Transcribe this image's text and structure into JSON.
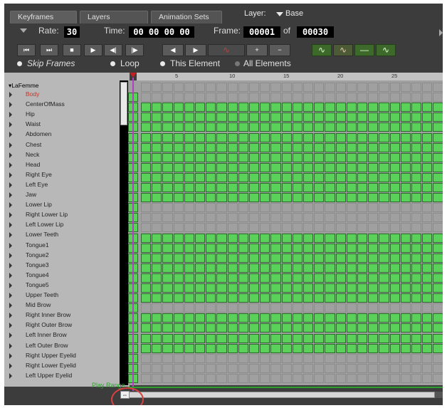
{
  "tabs": [
    {
      "label": "Keyframes",
      "active": true
    },
    {
      "label": "Layers",
      "active": false
    },
    {
      "label": "Animation Sets",
      "active": false
    }
  ],
  "layer": {
    "label": "Layer:",
    "value": "Base"
  },
  "rate": {
    "label": "Rate:",
    "value": "30"
  },
  "time": {
    "label": "Time:",
    "value": "00 00 00 00"
  },
  "frame": {
    "label": "Frame:",
    "value": "00001",
    "of_label": "of",
    "total": "00030"
  },
  "transport": [
    "⏮",
    "⏭",
    "■",
    "▶",
    "◀|",
    "|▶"
  ],
  "nav": [
    "◀",
    "▶"
  ],
  "key_tools": [
    "∿",
    "+",
    "−"
  ],
  "interp_buttons": [
    "∿",
    "∿",
    "—",
    "∿"
  ],
  "options": {
    "skip_frames": "Skip Frames",
    "loop": "Loop",
    "this_element": "This Element",
    "all_elements": "All Elements"
  },
  "ruler_ticks": [
    "5",
    "10",
    "15",
    "20",
    "25"
  ],
  "figure": "LaFemme",
  "rows": [
    {
      "label": "Body",
      "selected": true,
      "keys": false
    },
    {
      "label": "CenterOfMass",
      "keys": true
    },
    {
      "label": "Hip",
      "keys": true
    },
    {
      "label": "Waist",
      "keys": true
    },
    {
      "label": "Abdomen",
      "keys": true
    },
    {
      "label": "Chest",
      "keys": true
    },
    {
      "label": "Neck",
      "keys": true
    },
    {
      "label": "Head",
      "keys": true
    },
    {
      "label": "Right Eye",
      "keys": true
    },
    {
      "label": "Left Eye",
      "keys": true
    },
    {
      "label": "Jaw",
      "keys": true
    },
    {
      "label": "Lower Lip",
      "keys": false
    },
    {
      "label": "Right Lower Lip",
      "keys": false
    },
    {
      "label": "Left Lower Lip",
      "keys": false
    },
    {
      "label": "Lower Teeth",
      "keys": true
    },
    {
      "label": "Tongue1",
      "keys": true
    },
    {
      "label": "Tongue2",
      "keys": true
    },
    {
      "label": "Tongue3",
      "keys": true
    },
    {
      "label": "Tongue4",
      "keys": true
    },
    {
      "label": "Tongue5",
      "keys": true
    },
    {
      "label": "Upper Teeth",
      "keys": true
    },
    {
      "label": "Mid Brow",
      "keys": false
    },
    {
      "label": "Right Inner Brow",
      "keys": true
    },
    {
      "label": "Right Outer Brow",
      "keys": true
    },
    {
      "label": "Left Inner Brow",
      "keys": true
    },
    {
      "label": "Left Outer Brow",
      "keys": true
    },
    {
      "label": "Right Upper Eyelid",
      "keys": false
    },
    {
      "label": "Right Lower Eyelid",
      "keys": false
    },
    {
      "label": "Left Upper Eyelid",
      "keys": false
    }
  ],
  "play_range": "Play Range",
  "bottom_handle": "⇔",
  "colors": {
    "key_on": "#5ad25a",
    "key_off": "#a0a0a0",
    "selected_row": "#c0392b",
    "play_range": "#2fa02f",
    "annotation": "#d94040"
  }
}
